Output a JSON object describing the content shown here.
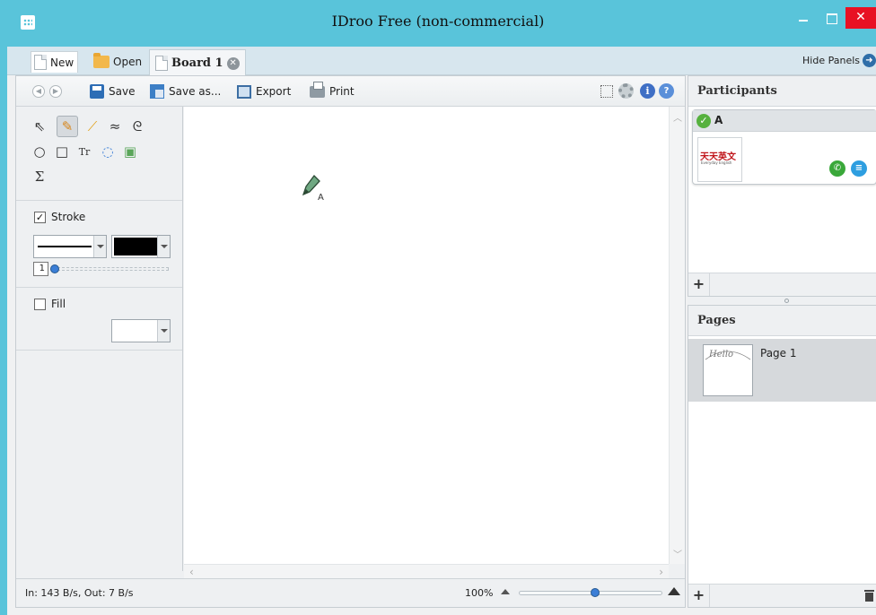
{
  "window": {
    "title": "IDroo Free (non-commercial)",
    "close_glyph": "✕",
    "accent_color": "#59c4da"
  },
  "tabbar": {
    "new_label": "New",
    "open_label": "Open",
    "board_tab_label": "Board 1",
    "hide_panels_label": "Hide Panels"
  },
  "toolbar": {
    "save_label": "Save",
    "save_as_label": "Save as...",
    "export_label": "Export",
    "print_label": "Print",
    "info_glyph": "i",
    "help_glyph": "?"
  },
  "tools": {
    "items": [
      {
        "name": "select-tool-icon",
        "glyph": "⇖"
      },
      {
        "name": "pencil-tool-icon",
        "glyph": "✎"
      },
      {
        "name": "highlighter-tool-icon",
        "glyph": "⟋"
      },
      {
        "name": "curve-tool-icon",
        "glyph": "≈"
      },
      {
        "name": "spiral-tool-icon",
        "glyph": "ᘓ"
      },
      {
        "name": "ellipse-tool-icon",
        "glyph": "○"
      },
      {
        "name": "rectangle-tool-icon",
        "glyph": "□"
      },
      {
        "name": "text-tool-icon",
        "glyph": "Tr"
      },
      {
        "name": "callout-tool-icon",
        "glyph": "◌"
      },
      {
        "name": "image-tool-icon",
        "glyph": "▣"
      },
      {
        "name": "formula-tool-icon",
        "glyph": "Σ"
      }
    ],
    "stroke_label": "Stroke",
    "stroke_checked": true,
    "stroke_width": "1",
    "stroke_color": "#000000",
    "fill_label": "Fill",
    "fill_checked": false,
    "fill_color": "#ffffff"
  },
  "canvas": {
    "cursor_user": "A"
  },
  "status": {
    "net_stats": "In: 143 B/s, Out: 7 B/s",
    "zoom": "100%"
  },
  "participants": {
    "header": "Participants",
    "items": [
      {
        "name": "A",
        "avatar_text": "天天英文",
        "avatar_sub": "Everyday English"
      }
    ],
    "add_glyph": "+"
  },
  "pages": {
    "header": "Pages",
    "items": [
      {
        "name": "Page 1",
        "thumb_text": "Hello"
      }
    ],
    "add_glyph": "+"
  }
}
